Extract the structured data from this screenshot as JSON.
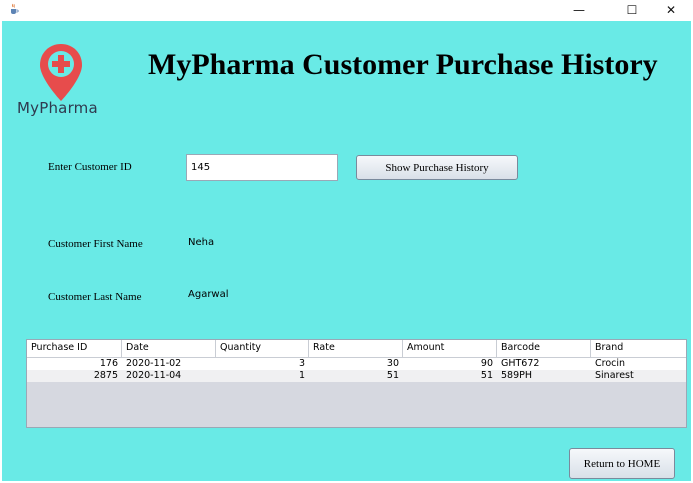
{
  "window": {
    "minimize_glyph": "—",
    "maximize_glyph": "☐",
    "close_glyph": "✕",
    "app_icon": "java-cup-icon"
  },
  "brand": {
    "logo_icon": "location-pin-plus-icon",
    "logo_text": "MyPharma",
    "accent_color": "#E74C4C",
    "background_color": "#69EAE6"
  },
  "header": {
    "title": "MyPharma Customer Purchase History"
  },
  "form": {
    "customer_id_label": "Enter Customer ID",
    "customer_id_value": "145",
    "show_button_label": "Show Purchase History",
    "first_name_label": "Customer First Name",
    "first_name_value": "Neha",
    "last_name_label": "Customer Last Name",
    "last_name_value": "Agarwal"
  },
  "table": {
    "columns": [
      "Purchase ID",
      "Date",
      "Quantity",
      "Rate",
      "Amount",
      "Barcode",
      "Brand"
    ],
    "rows": [
      [
        "176",
        "2020-11-02",
        "3",
        "30",
        "90",
        "GHT672",
        "Crocin"
      ],
      [
        "2875",
        "2020-11-04",
        "1",
        "51",
        "51",
        "589PH",
        "Sinarest"
      ]
    ]
  },
  "footer": {
    "home_button_label": "Return to HOME"
  }
}
